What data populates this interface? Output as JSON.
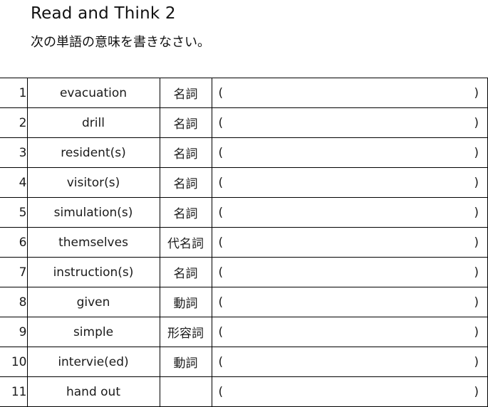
{
  "header": {
    "title": "Read and Think 2",
    "instruction": "次の単語の意味を書きなさい。"
  },
  "table": {
    "paren_open": "(",
    "paren_close": ")",
    "rows": [
      {
        "num": "1",
        "word": "evacuation",
        "pos": "名詞",
        "answer": ""
      },
      {
        "num": "2",
        "word": "drill",
        "pos": "名詞",
        "answer": ""
      },
      {
        "num": "3",
        "word": "resident(s)",
        "pos": "名詞",
        "answer": ""
      },
      {
        "num": "4",
        "word": "visitor(s)",
        "pos": "名詞",
        "answer": ""
      },
      {
        "num": "5",
        "word": "simulation(s)",
        "pos": "名詞",
        "answer": ""
      },
      {
        "num": "6",
        "word": "themselves",
        "pos": "代名詞",
        "answer": ""
      },
      {
        "num": "7",
        "word": "instruction(s)",
        "pos": "名詞",
        "answer": ""
      },
      {
        "num": "8",
        "word": "given",
        "pos": "動詞",
        "answer": ""
      },
      {
        "num": "9",
        "word": "simple",
        "pos": "形容詞",
        "answer": ""
      },
      {
        "num": "10",
        "word": "intervie(ed)",
        "pos": "動詞",
        "answer": ""
      },
      {
        "num": "11",
        "word": "hand out",
        "pos": "",
        "answer": ""
      }
    ]
  }
}
